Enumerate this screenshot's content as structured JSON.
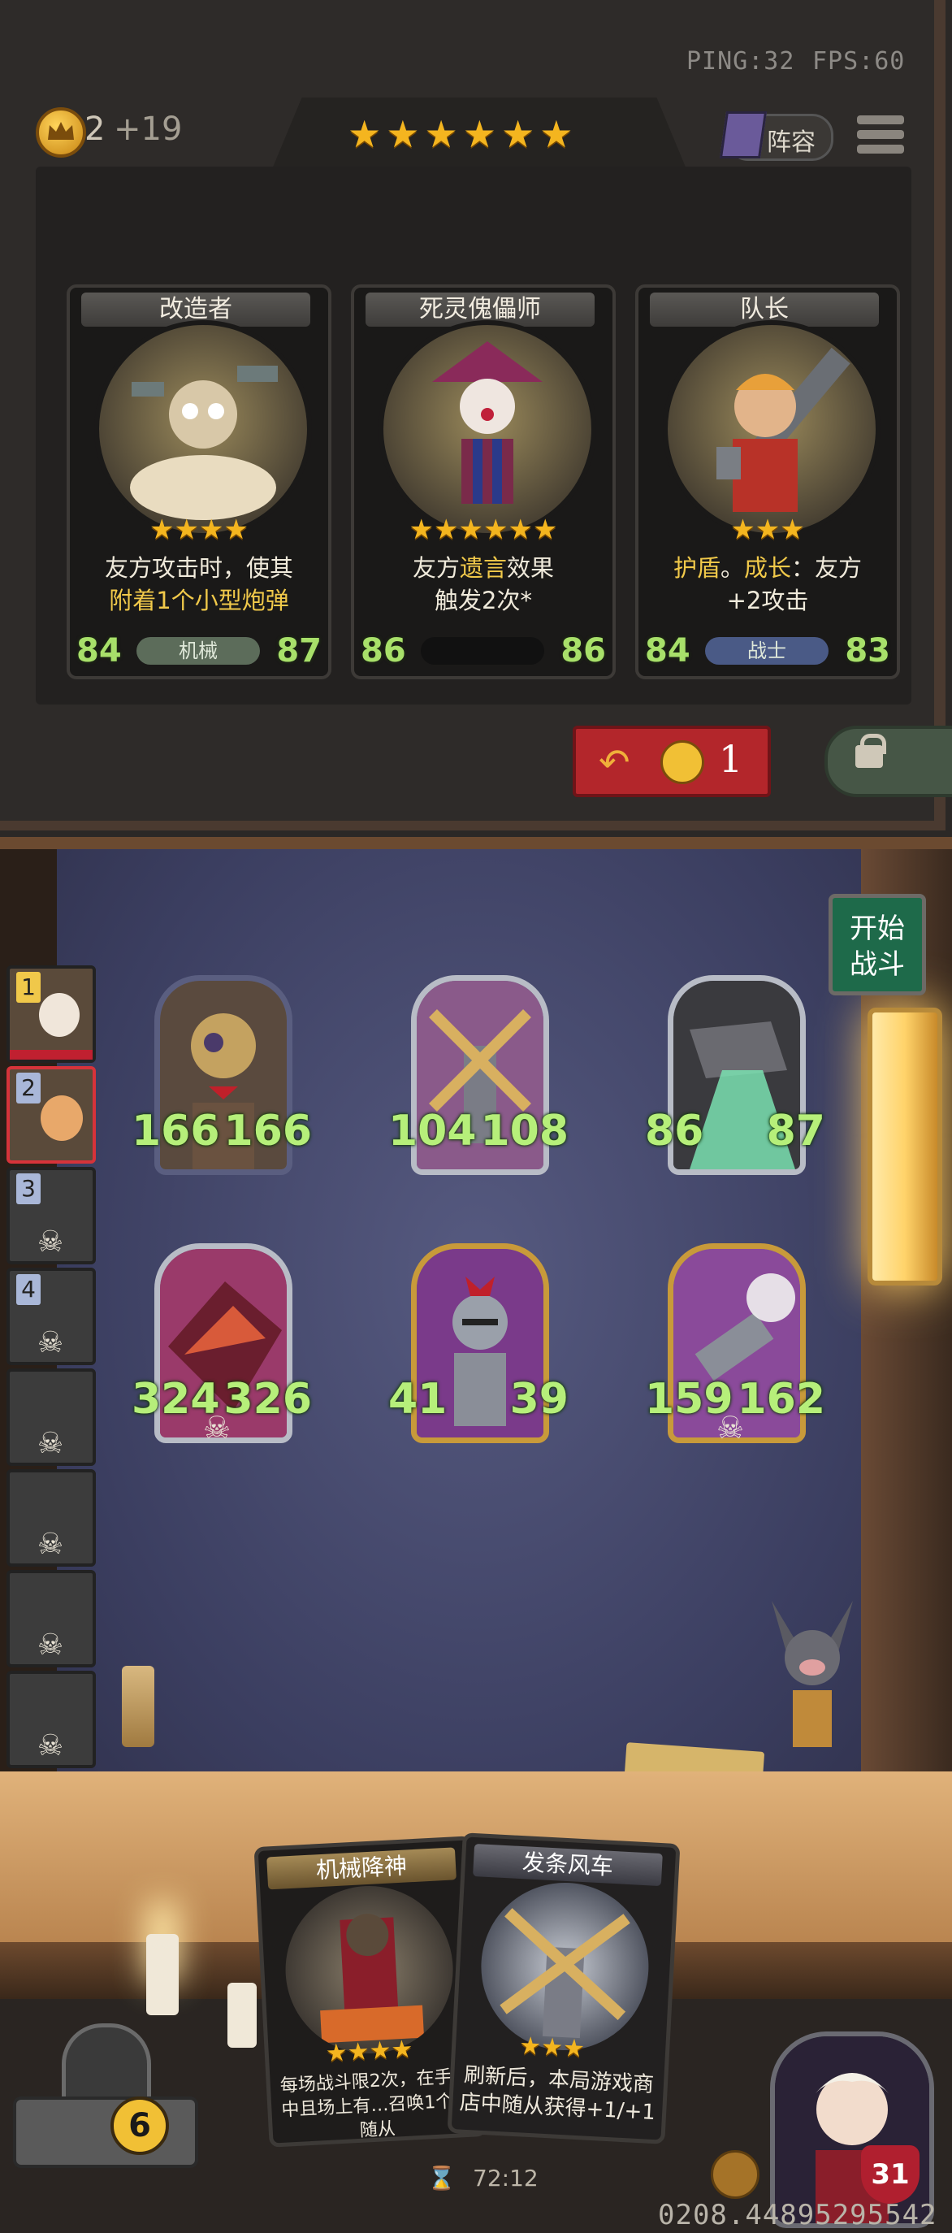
{
  "status": {
    "ping": "PING:32",
    "fps": "FPS:60"
  },
  "gold": {
    "amount": "2",
    "income": "+19"
  },
  "tavern_stars": "★★★★★★",
  "lineup_label": "阵容",
  "offers": [
    {
      "name": "改造者",
      "stars": "★★★★",
      "desc_line1": "友方攻击时，使其",
      "desc_line2_pre": "附着1个",
      "desc_line2_hl": "小型炮弹",
      "attack": "84",
      "health": "87",
      "tribe": "机械"
    },
    {
      "name": "死灵傀儡师",
      "stars": "★★★★★★",
      "desc_line1_pre": "友方",
      "desc_line1_hl": "遗言",
      "desc_line1_post": "效果",
      "desc_line2": "触发2次*",
      "attack": "86",
      "health": "86",
      "tribe": ""
    },
    {
      "name": "队长",
      "stars": "★★★",
      "desc_line1_hl1": "护盾",
      "desc_line1_mid": "。",
      "desc_line1_hl2": "成长",
      "desc_line1_post": "：友方",
      "desc_line2": "+2攻击",
      "attack": "84",
      "health": "83",
      "tribe": "战士"
    }
  ],
  "refresh": {
    "cost": "1"
  },
  "start_battle": {
    "line1": "开始",
    "line2": "战斗"
  },
  "players": [
    "1",
    "2",
    "3",
    "4"
  ],
  "board": [
    {
      "attack": "166",
      "health": "166"
    },
    {
      "attack": "104",
      "health": "108"
    },
    {
      "attack": "86",
      "health": "87"
    },
    {
      "attack": "324",
      "health": "326"
    },
    {
      "attack": "41",
      "health": "39"
    },
    {
      "attack": "159",
      "health": "162"
    }
  ],
  "hand": [
    {
      "name": "机械降神",
      "stars": "★★★★",
      "desc": "每场战斗限2次，在手牌中且场上有…召唤1个本随从"
    },
    {
      "name": "发条风车",
      "stars": "★★★",
      "desc": "刷新后，本局游戏商店中随从获得+1/+1"
    }
  ],
  "deck_count": "6",
  "hero_health": "31",
  "timer": "72:12",
  "seed": "0208.44895295542",
  "colors": {
    "accent_star": "#f4b51f",
    "stat_green": "#a8e06a",
    "refresh_red": "#b3262b",
    "start_green": "#1e6a4a"
  }
}
